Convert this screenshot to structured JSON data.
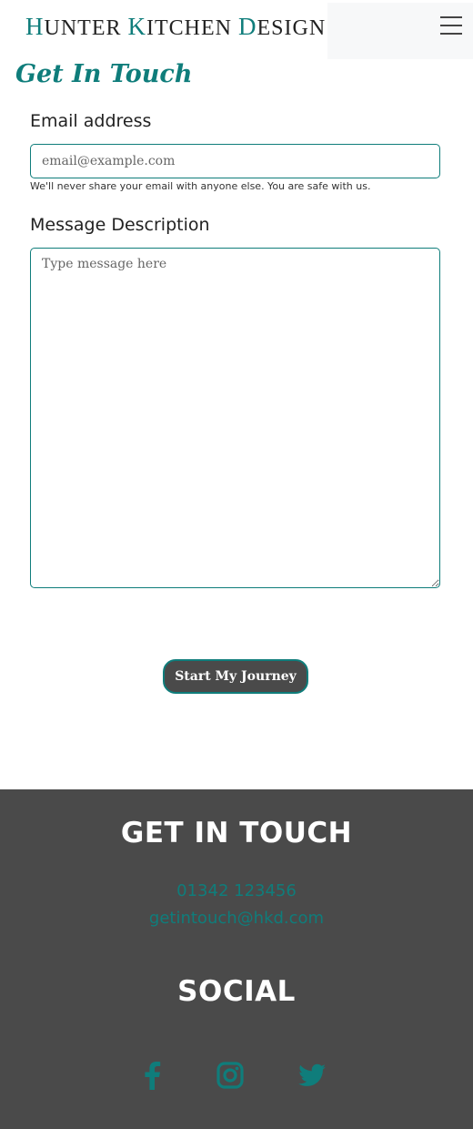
{
  "header": {
    "brand_parts": [
      {
        "big": "H",
        "rest": "UNTER "
      },
      {
        "big": "K",
        "rest": "ITCHEN "
      },
      {
        "big": "D",
        "rest": "ESIGN"
      }
    ],
    "menu_icon": "hamburger-icon"
  },
  "form": {
    "title": "Get In Touch",
    "email_label": "Email address",
    "email_placeholder": "email@example.com",
    "email_help": "We'll never share your email with anyone else. You are safe with us.",
    "message_label": "Message Description",
    "message_placeholder": "Type message here",
    "submit_label": "Start My Journey"
  },
  "footer": {
    "contact_heading": "GET IN TOUCH",
    "phone": "01342 123456",
    "email": "getintouch@hkd.com",
    "social_heading": "SOCIAL",
    "social_icons": [
      "facebook-icon",
      "instagram-icon",
      "twitter-icon"
    ]
  },
  "colors": {
    "accent": "#0f7d7b",
    "dark": "#4a4a4a",
    "white": "#ffffff"
  }
}
